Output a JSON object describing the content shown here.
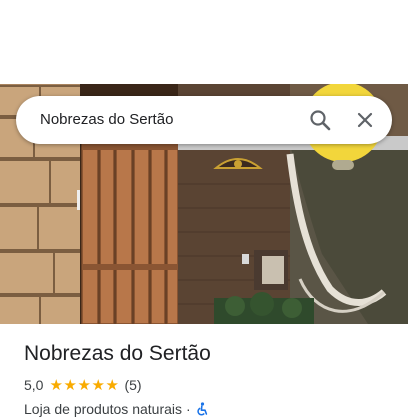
{
  "search": {
    "query": "Nobrezas do Sertão"
  },
  "icons": {
    "search": "search-icon",
    "close": "close-icon",
    "accessibility": "wheelchair-icon"
  },
  "place": {
    "title": "Nobrezas do Sertão",
    "rating": "5,0",
    "stars": 5,
    "reviews": "(5)",
    "category": "Loja de produtos naturais",
    "separator": "·"
  },
  "colors": {
    "star": "#f9ab00",
    "accessibility_icon": "#1a73e8"
  }
}
